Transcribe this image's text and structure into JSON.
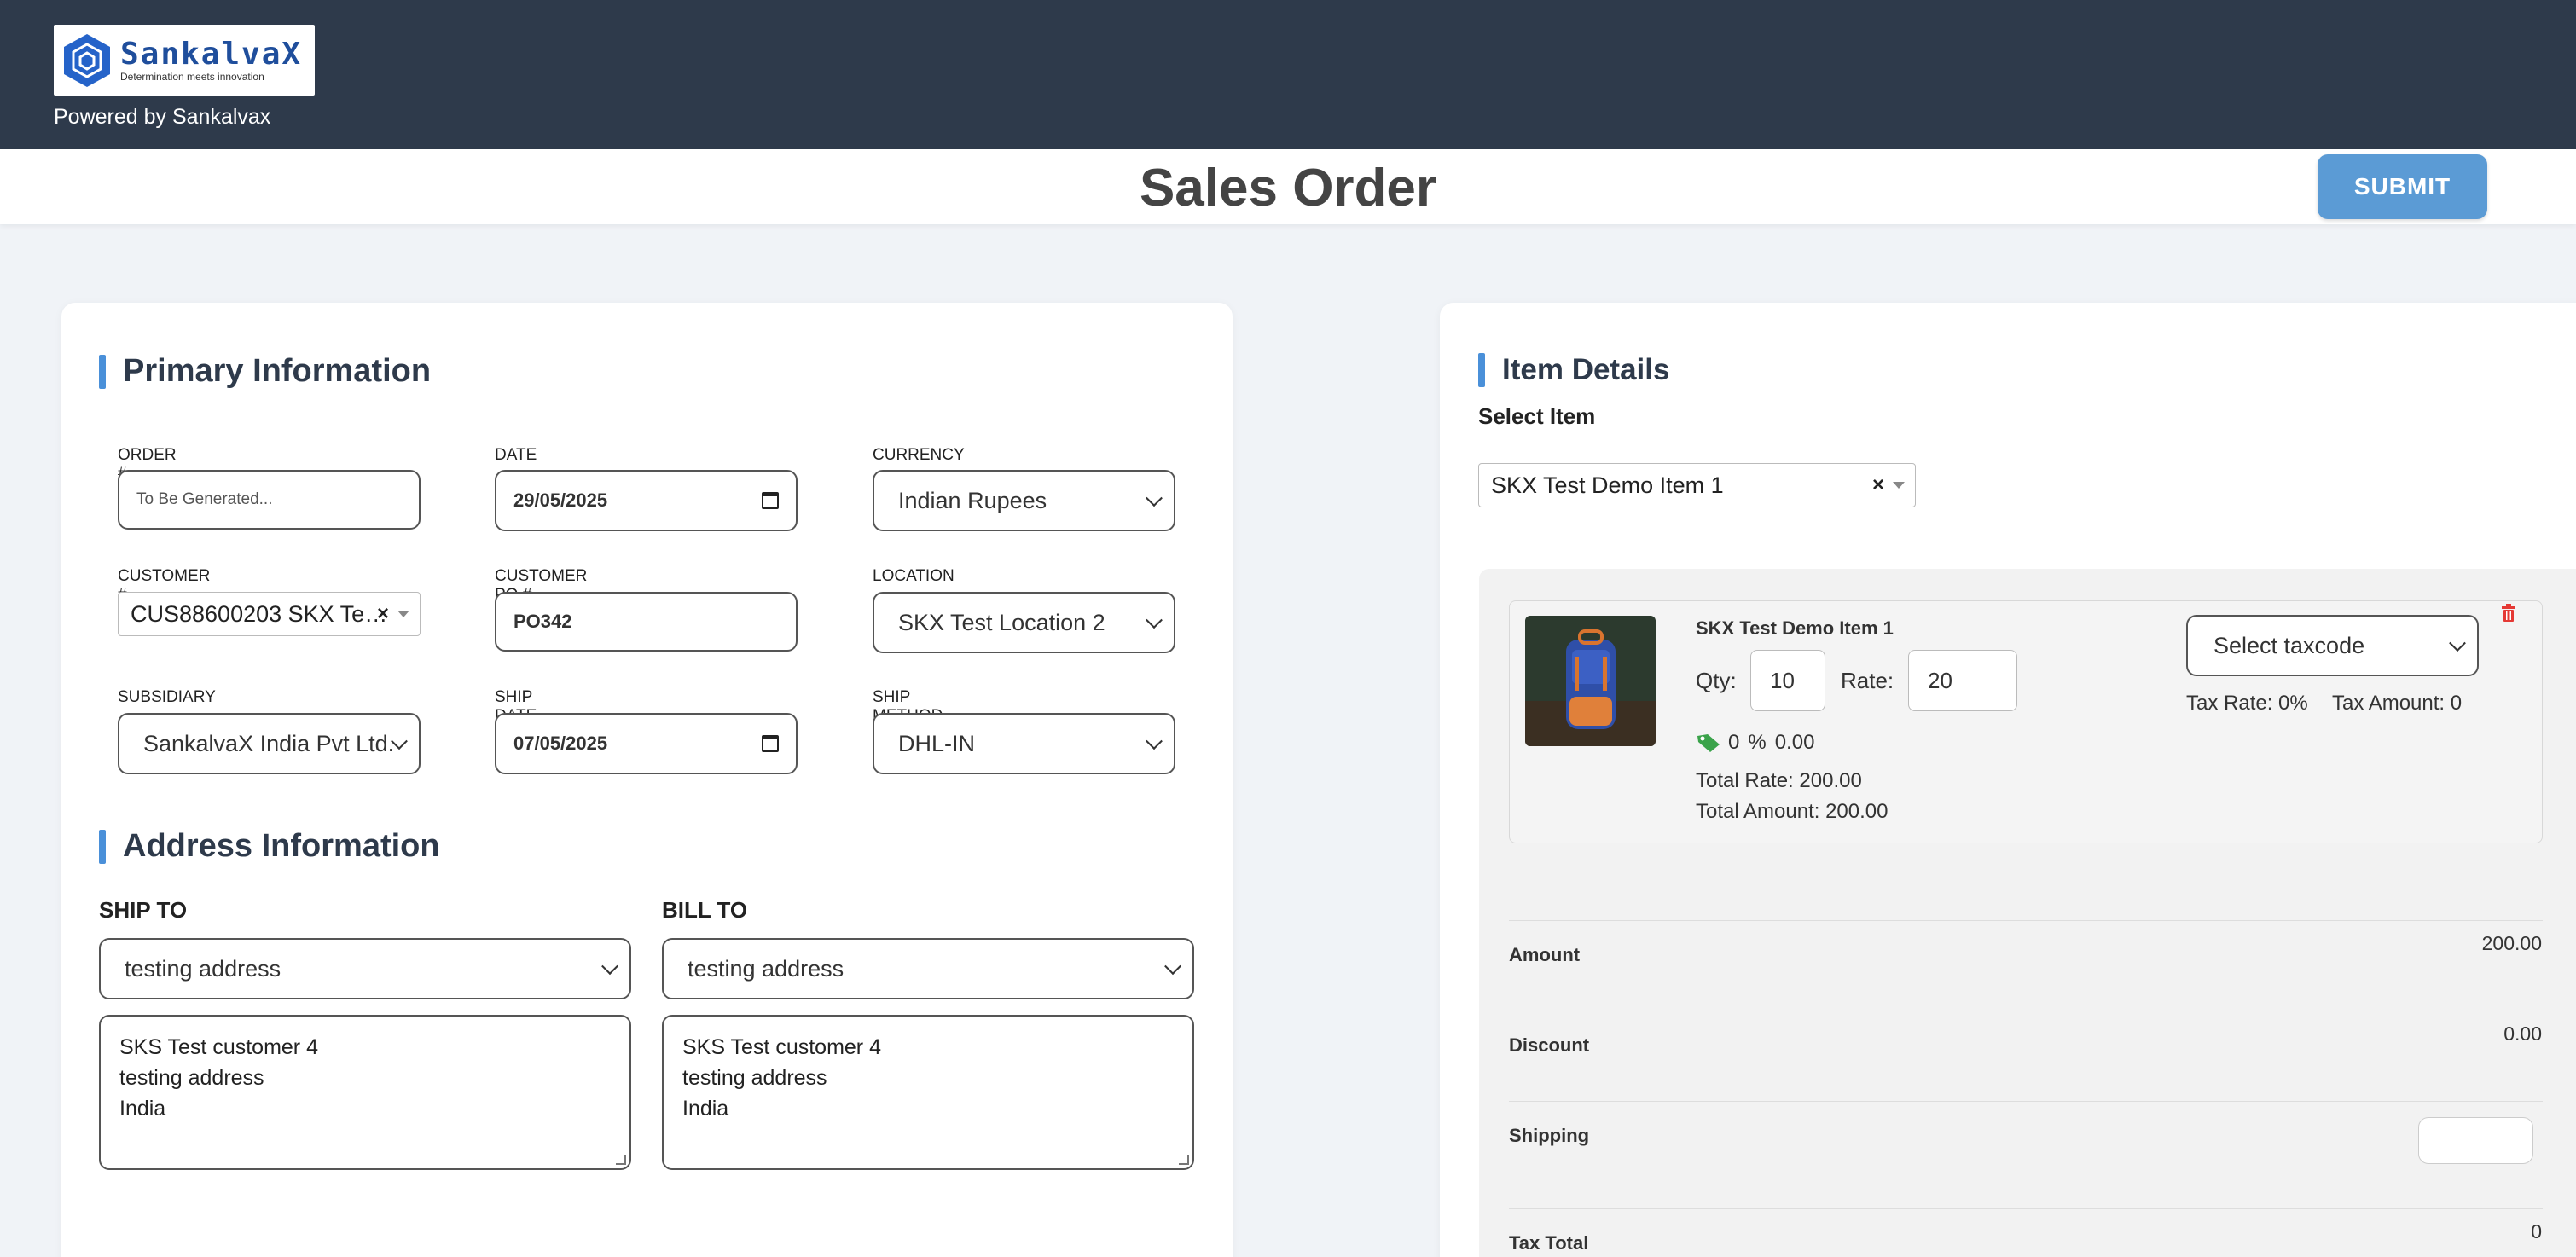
{
  "header": {
    "logo_name": "SankalvaX",
    "logo_tagline": "Determination meets innovation",
    "powered_by": "Powered by Sankalvax"
  },
  "titlebar": {
    "title": "Sales Order",
    "submit_label": "SUBMIT"
  },
  "primary": {
    "section_title": "Primary Information",
    "order_no": {
      "label": "ORDER #",
      "placeholder": "To Be Generated..."
    },
    "date": {
      "label": "DATE",
      "value": "29/05/2025"
    },
    "currency": {
      "label": "CURRENCY",
      "value": "Indian Rupees"
    },
    "customer_no": {
      "label": "CUSTOMER #",
      "value": "CUS88600203 SKX Te…"
    },
    "customer_po": {
      "label": "CUSTOMER PO #",
      "value": "PO342"
    },
    "location": {
      "label": "LOCATION",
      "value": "SKX Test Location 2"
    },
    "subsidiary": {
      "label": "SUBSIDIARY",
      "value": "SankalvaX India Pvt Ltd."
    },
    "ship_date": {
      "label": "SHIP DATE",
      "value": "07/05/2025"
    },
    "ship_method": {
      "label": "SHIP METHOD",
      "value": "DHL-IN"
    }
  },
  "address": {
    "section_title": "Address Information",
    "ship_to": {
      "label": "SHIP TO",
      "select_value": "testing address",
      "lines": [
        "SKS Test customer 4",
        "testing address",
        "India"
      ]
    },
    "bill_to": {
      "label": "BILL TO",
      "select_value": "testing address",
      "lines": [
        "SKS Test customer 4",
        "testing address",
        "India"
      ]
    }
  },
  "items": {
    "section_title": "Item Details",
    "select_label": "Select Item",
    "selected_item": "SKX Test Demo Item 1",
    "line": {
      "name": "SKX Test Demo Item 1",
      "qty_label": "Qty:",
      "qty": "10",
      "rate_label": "Rate:",
      "rate": "20",
      "discount_pct": "0",
      "discount_pct_symbol": "%",
      "discount_amount": "0.00",
      "total_rate": "Total Rate: 200.00",
      "total_amount": "Total Amount: 200.00",
      "taxcode_placeholder": "Select taxcode",
      "tax_rate": "Tax Rate: 0%",
      "tax_amount": "Tax Amount: 0",
      "image_icon": "backpack-image"
    }
  },
  "totals": {
    "amount_label": "Amount",
    "amount": "200.00",
    "discount_label": "Discount",
    "discount": "0.00",
    "shipping_label": "Shipping",
    "tax_total_label": "Tax Total",
    "tax_total": "0"
  },
  "colors": {
    "header_bg": "#2e3a4b",
    "accent": "#4a90d9",
    "submit_bg": "#5b9bd5",
    "delete": "#e53935"
  }
}
